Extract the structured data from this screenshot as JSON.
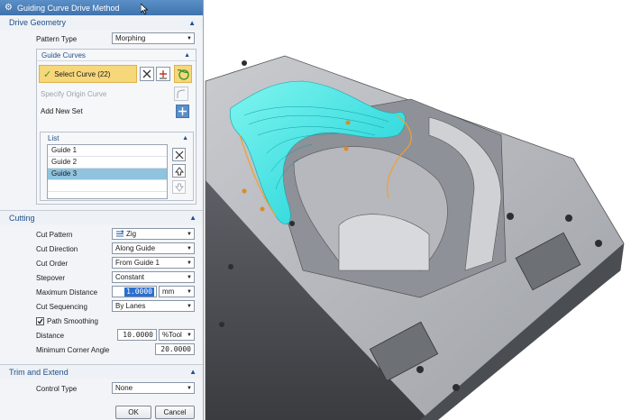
{
  "window": {
    "title": "Guiding Curve Drive Method"
  },
  "drive_geometry": {
    "header": "Drive Geometry",
    "pattern_type_label": "Pattern Type",
    "pattern_type_value": "Morphing",
    "guide_curves": {
      "header": "Guide Curves",
      "select_curve_label": "Select Curve (22)",
      "specify_origin_label": "Specify Origin Curve",
      "add_new_set_label": "Add New Set",
      "list": {
        "header": "List",
        "items": [
          "Guide  1",
          "Guide  2",
          "Guide  3"
        ],
        "selected_index": 2
      }
    }
  },
  "cutting": {
    "header": "Cutting",
    "cut_pattern_label": "Cut Pattern",
    "cut_pattern_value": "Zig",
    "cut_direction_label": "Cut Direction",
    "cut_direction_value": "Along Guide",
    "cut_order_label": "Cut Order",
    "cut_order_value": "From Guide 1",
    "stepover_label": "Stepover",
    "stepover_value": "Constant",
    "max_distance_label": "Maximum Distance",
    "max_distance_value": "1.0000",
    "max_distance_unit": "mm",
    "cut_sequencing_label": "Cut Sequencing",
    "cut_sequencing_value": "By Lanes",
    "path_smoothing_label": "Path Smoothing",
    "path_smoothing_checked": true,
    "distance_label": "Distance",
    "distance_value": "10.0000",
    "distance_unit": "%Tool",
    "min_corner_angle_label": "Minimum Corner Angle",
    "min_corner_angle_value": "20.0000"
  },
  "trim_extend": {
    "header": "Trim and Extend",
    "control_type_label": "Control Type",
    "control_type_value": "None"
  },
  "footer": {
    "ok_label": "OK",
    "cancel_label": "Cancel"
  },
  "colors": {
    "titlebar": "#4a7fba",
    "section_text": "#1f4e8c",
    "selection_highlight": "#f6d77a",
    "list_selected": "#8fc3de",
    "toolpath": "#2ee6e0",
    "model_gray": "#9a9da3"
  },
  "icons": {
    "title": "gear-icon",
    "check": "check-icon",
    "remove": "remove-icon",
    "add_curve": "add-curve-icon",
    "curve_select": "curve-select-icon",
    "new_set": "add-set-icon",
    "move_up": "move-up-icon",
    "move_down": "move-down-icon",
    "delete": "delete-icon"
  }
}
